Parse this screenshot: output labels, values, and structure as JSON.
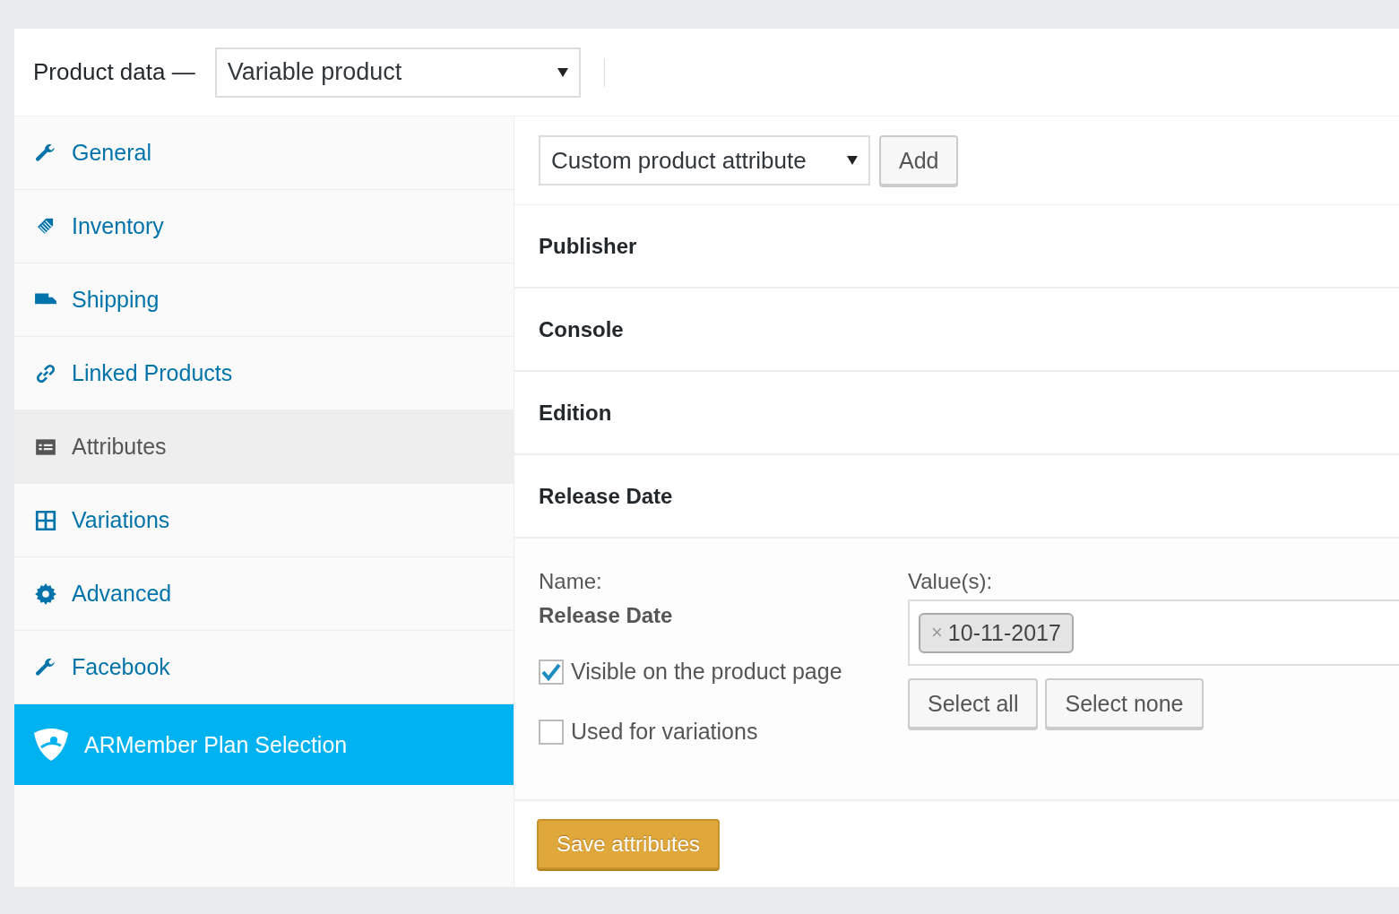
{
  "header": {
    "title": "Product data —",
    "product_type": "Variable product"
  },
  "sidebar": {
    "items": [
      {
        "label": "General",
        "selected": false,
        "kind": "tab"
      },
      {
        "label": "Inventory",
        "selected": false,
        "kind": "tab"
      },
      {
        "label": "Shipping",
        "selected": false,
        "kind": "tab"
      },
      {
        "label": "Linked Products",
        "selected": false,
        "kind": "tab"
      },
      {
        "label": "Attributes",
        "selected": true,
        "kind": "tab"
      },
      {
        "label": "Variations",
        "selected": false,
        "kind": "tab"
      },
      {
        "label": "Advanced",
        "selected": false,
        "kind": "tab"
      },
      {
        "label": "Facebook",
        "selected": false,
        "kind": "tab"
      },
      {
        "label": "ARMember Plan Selection",
        "selected": false,
        "kind": "promo"
      }
    ]
  },
  "toolbar": {
    "attribute_select": "Custom product attribute",
    "add_button": "Add"
  },
  "attributes": [
    {
      "name": "Publisher"
    },
    {
      "name": "Console"
    },
    {
      "name": "Edition"
    },
    {
      "name": "Release Date",
      "detail": {
        "name_label": "Name:",
        "name_value": "Release Date",
        "values_label": "Value(s):",
        "tags": [
          "10-11-2017"
        ],
        "tag_remove": "×",
        "options": [
          {
            "label": "Visible on the product page",
            "checked": true
          },
          {
            "label": "Used for variations",
            "checked": false
          }
        ],
        "select_all": "Select all",
        "select_none": "Select none"
      }
    }
  ],
  "save_button": "Save attributes"
}
